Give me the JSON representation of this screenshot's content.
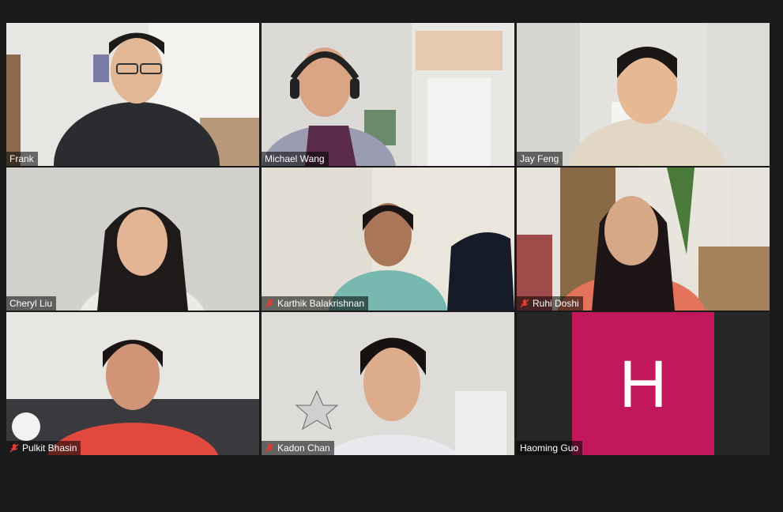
{
  "meeting": {
    "participants": [
      {
        "name": "Frank",
        "muted": false,
        "active_speaker": false
      },
      {
        "name": "Michael Wang",
        "muted": false,
        "active_speaker": false
      },
      {
        "name": "Jay Feng",
        "muted": false,
        "active_speaker": true
      },
      {
        "name": "Cheryl Liu",
        "muted": false,
        "active_speaker": false
      },
      {
        "name": "Karthik Balakrishnan",
        "muted": true,
        "active_speaker": false
      },
      {
        "name": "Ruhi Doshi",
        "muted": true,
        "active_speaker": false
      },
      {
        "name": "Pulkit Bhasin",
        "muted": true,
        "active_speaker": false
      },
      {
        "name": "Kadon Chan",
        "muted": true,
        "active_speaker": false
      },
      {
        "name": "Haoming Guo",
        "muted": false,
        "active_speaker": false,
        "avatar_letter": "H",
        "avatar_color": "#c2185b"
      }
    ]
  },
  "colors": {
    "background": "#1a1a1a",
    "active_speaker_border": "#c9e26b",
    "mute_icon": "#e03c31"
  }
}
